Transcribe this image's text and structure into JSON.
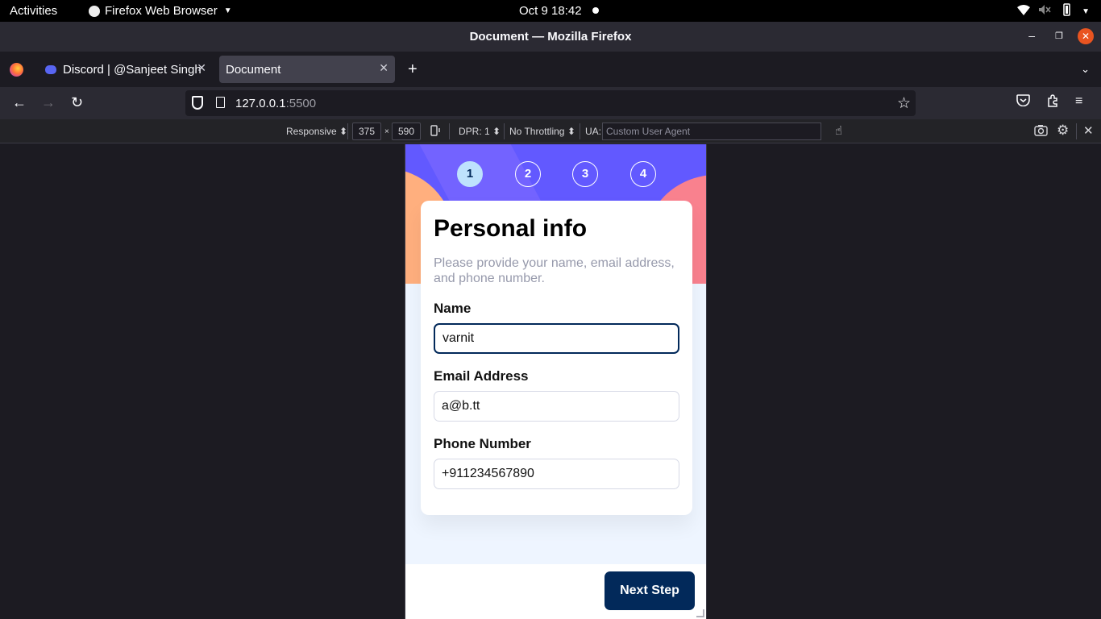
{
  "system_bar": {
    "activities": "Activities",
    "app_name": "Firefox Web Browser",
    "clock": "Oct 9  18:42"
  },
  "window": {
    "title": "Document — Mozilla Firefox"
  },
  "tabs": [
    {
      "label": "Discord | @Sanjeet Singh",
      "active": false
    },
    {
      "label": "Document",
      "active": true
    }
  ],
  "navbar": {
    "url_host": "127.0.0.1",
    "url_port": ":5500"
  },
  "rdm": {
    "device": "Responsive",
    "width": "375",
    "times": "×",
    "height": "590",
    "dpr": "DPR: 1",
    "throttling": "No Throttling",
    "ua_label": "UA:",
    "ua_placeholder": "Custom User Agent"
  },
  "form": {
    "steps": [
      "1",
      "2",
      "3",
      "4"
    ],
    "active_step": 1,
    "title": "Personal info",
    "subtitle": "Please provide your name, email address, and phone number.",
    "fields": [
      {
        "label": "Name",
        "value": "varnit"
      },
      {
        "label": "Email Address",
        "value": "a@b.tt"
      },
      {
        "label": "Phone Number",
        "value": "+911234567890"
      }
    ],
    "next_label": "Next Step"
  },
  "colors": {
    "primary": "#02295a",
    "hero_purple": "#6259ff",
    "orange_shape": "#ffaf7e",
    "pink_shape": "#f9818e",
    "page_bg": "#eef5ff"
  }
}
